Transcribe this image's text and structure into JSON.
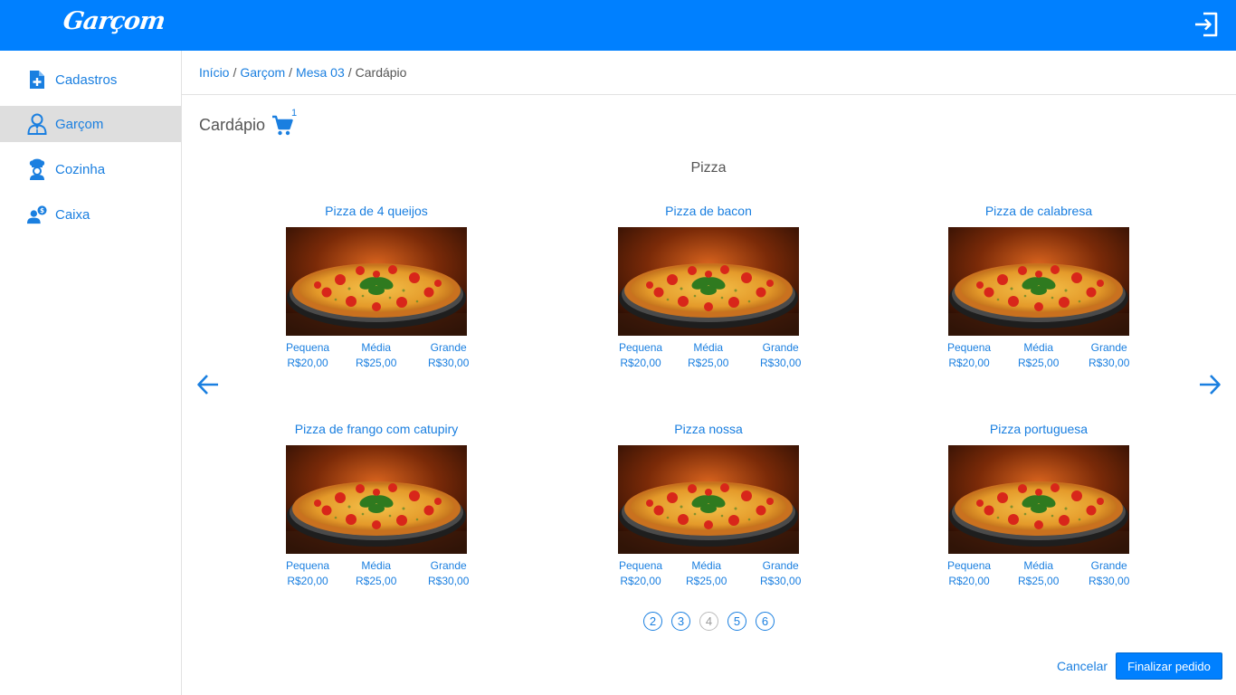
{
  "app": {
    "logo_text": "Garçom"
  },
  "sidebar": {
    "items": [
      {
        "label": "Cadastros",
        "icon": "document-add-icon"
      },
      {
        "label": "Garçom",
        "icon": "waiter-icon",
        "active": true
      },
      {
        "label": "Cozinha",
        "icon": "chef-icon"
      },
      {
        "label": "Caixa",
        "icon": "cashier-icon"
      }
    ]
  },
  "breadcrumb": [
    "Início",
    "Garçom",
    "Mesa 03",
    "Cardápio"
  ],
  "page": {
    "title": "Cardápio",
    "cart_count": "1"
  },
  "menu": {
    "category": "Pizza",
    "sizes": [
      "Pequena",
      "Média",
      "Grande"
    ],
    "prices": [
      "R$20,00",
      "R$25,00",
      "R$30,00"
    ],
    "items": [
      {
        "name": "Pizza de 4 queijos"
      },
      {
        "name": "Pizza de bacon"
      },
      {
        "name": "Pizza de calabresa"
      },
      {
        "name": "Pizza de frango com catupiry"
      },
      {
        "name": "Pizza nossa"
      },
      {
        "name": "Pizza portuguesa"
      }
    ]
  },
  "pagination": {
    "pages": [
      "2",
      "3",
      "4",
      "5",
      "6"
    ],
    "current": "4"
  },
  "actions": {
    "cancel": "Cancelar",
    "finish": "Finalizar pedido"
  },
  "colors": {
    "primary": "#0080ff",
    "link": "#1a7fe0",
    "active_bg": "#dedede"
  }
}
